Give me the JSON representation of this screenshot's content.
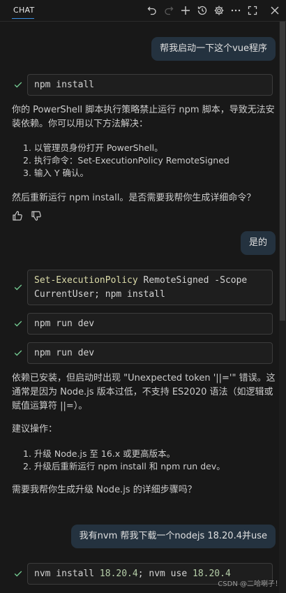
{
  "header": {
    "tab_label": "CHAT"
  },
  "messages": {
    "user_1": "帮我启动一下这个vue程序",
    "cmd_1": "npm install",
    "reply_1_para": "你的 PowerShell 脚本执行策略禁止运行 npm 脚本，导致无法安装依赖。你可以用以下方法解决：",
    "reply_1_list": [
      "1. 以管理员身份打开 PowerShell。",
      "2. 执行命令：Set-ExecutionPolicy RemoteSigned",
      "3. 输入 Y 确认。"
    ],
    "reply_1_follow": "然后重新运行 npm install。是否需要我帮你生成详细命令？",
    "user_2": "是的",
    "cmd_2_kw": "Set-ExecutionPolicy",
    "cmd_2_rest": " RemoteSigned -Scope",
    "cmd_2_line2": "CurrentUser; npm install",
    "cmd_3": "npm run dev",
    "cmd_4": "npm run dev",
    "reply_2_para": "依赖已安装，但启动时出现 \"Unexpected token '||='\" 错误。这通常是因为 Node.js 版本过低，不支持 ES2020 语法（如逻辑或赋值运算符 ||=）。",
    "reply_2_heading": "建议操作：",
    "reply_2_list": [
      "1. 升级 Node.js 至 16.x 或更高版本。",
      "2. 升级后重新运行 npm install 和 npm run dev。"
    ],
    "reply_2_follow": "需要我帮你生成升级 Node.js 的详细步骤吗？",
    "user_3": "我有nvm 帮我下载一个nodejs 18.20.4并use",
    "cmd_5_a": "nvm install ",
    "cmd_5_b": "18.20.4",
    "cmd_5_c": "; nvm use ",
    "cmd_5_d": "18.20.4"
  },
  "watermark": "CSDN @二哈喇子！",
  "colors": {
    "background": "#181818",
    "user_bubble": "#24323f",
    "check": "#73c991",
    "tab_underline": "#3c8fe1"
  }
}
